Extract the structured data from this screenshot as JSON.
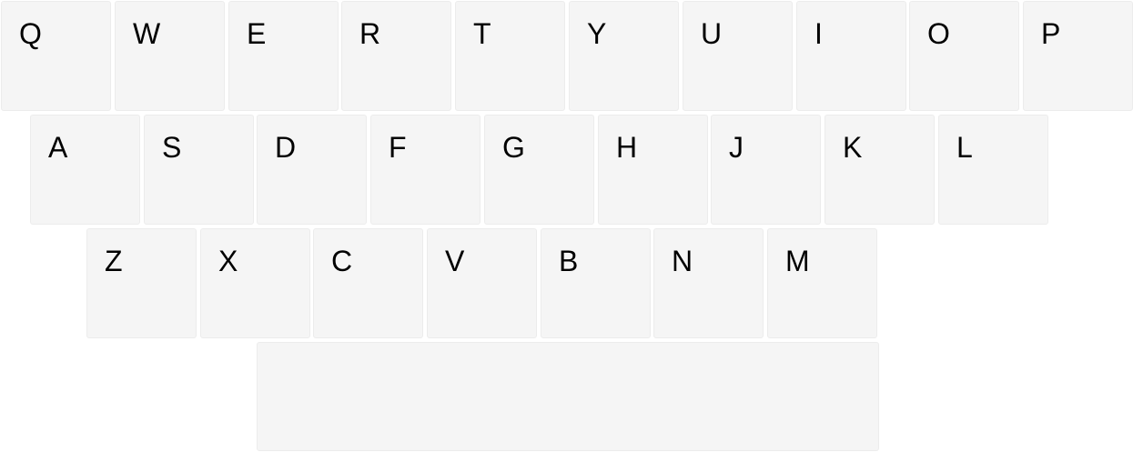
{
  "keyboard": {
    "rows": [
      [
        "Q",
        "W",
        "E",
        "R",
        "T",
        "Y",
        "U",
        "I",
        "O",
        "P"
      ],
      [
        "A",
        "S",
        "D",
        "F",
        "G",
        "H",
        "J",
        "K",
        "L"
      ],
      [
        "Z",
        "X",
        "C",
        "V",
        "B",
        "N",
        "M"
      ]
    ],
    "space_label": ""
  }
}
